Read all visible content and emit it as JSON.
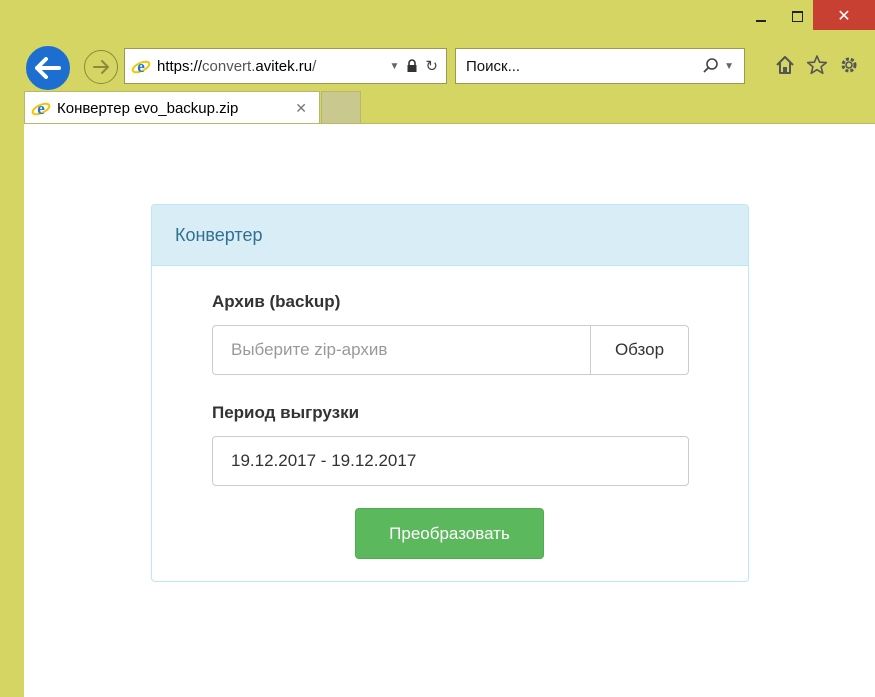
{
  "window": {
    "minimize_icon": "minimize-icon",
    "maximize_icon": "maximize-icon",
    "close_glyph": "✕"
  },
  "address_bar": {
    "url_protocol": "https://",
    "url_host_prefix": "convert.",
    "url_host": "avitek.ru",
    "url_tail": "/",
    "dropdown_glyph": "▼",
    "refresh_glyph": "↻"
  },
  "search": {
    "placeholder": "Поиск...",
    "dropdown_glyph": "▼"
  },
  "tabs": [
    {
      "title": "Конвертер evo_backup.zip",
      "close_glyph": "✕",
      "active": true
    }
  ],
  "panel": {
    "heading": "Конвертер",
    "archive_label": "Архив (backup)",
    "archive_placeholder": "Выберите zip-архив",
    "browse_label": "Обзор",
    "period_label": "Период выгрузки",
    "period_value": "19.12.2017 - 19.12.2017",
    "submit_label": "Преобразовать"
  },
  "colors": {
    "frame": "#d5d564",
    "close_button": "#c84031",
    "back_button": "#1c6fd0",
    "panel_heading_bg": "#d9edf7",
    "panel_heading_text": "#31708f",
    "success_button": "#5cb85c"
  }
}
